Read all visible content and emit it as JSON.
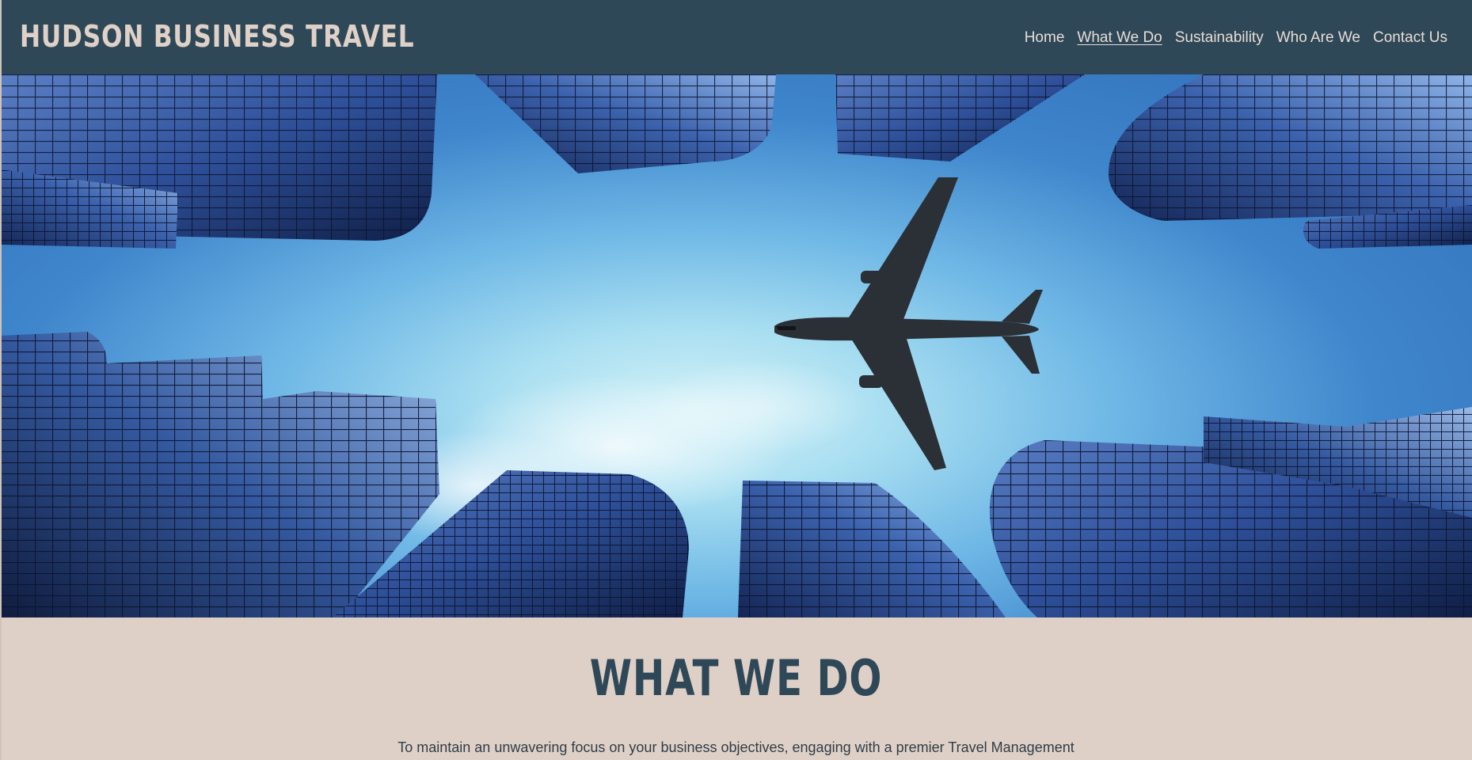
{
  "header": {
    "brand": "HUDSON BUSINESS TRAVEL",
    "nav": [
      {
        "label": "Home",
        "active": false
      },
      {
        "label": "What We Do",
        "active": true
      },
      {
        "label": "Sustainability",
        "active": false
      },
      {
        "label": "Who Are We",
        "active": false
      },
      {
        "label": "Contact Us",
        "active": false
      }
    ]
  },
  "hero": {
    "image": "skyscrapers-and-airplane-photo"
  },
  "section": {
    "title": "WHAT WE DO",
    "text": "To maintain an unwavering focus on your business objectives, engaging with a premier Travel Management"
  },
  "colors": {
    "header_bg": "#2f4858",
    "brand_text": "#dfd1c8",
    "section_bg": "#dfd0c7",
    "title_text": "#2f4858"
  }
}
